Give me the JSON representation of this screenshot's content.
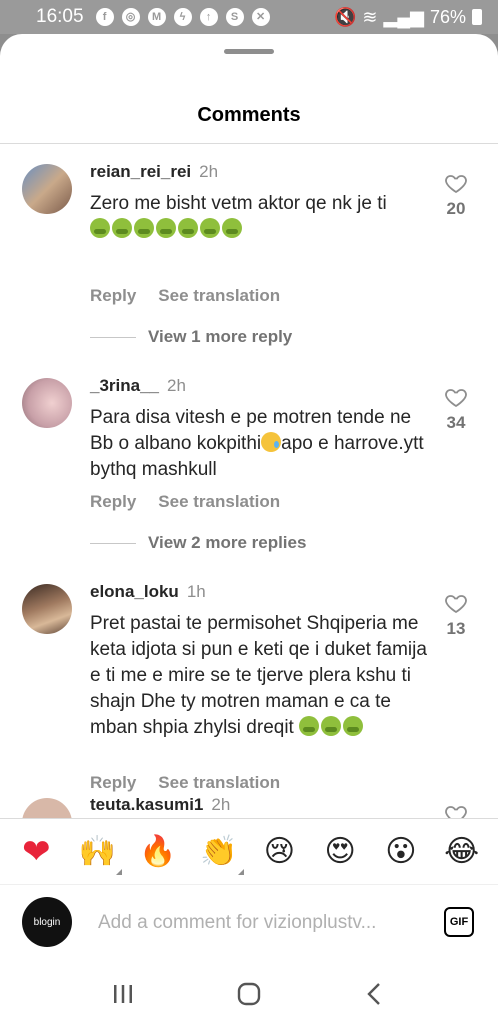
{
  "status_bar": {
    "time": "16:05",
    "battery": "76%",
    "icons": [
      "facebook-icon",
      "instagram-icon",
      "gmail-icon",
      "messenger-icon",
      "upload-icon",
      "shazam-icon",
      "close-box-icon",
      "mute-icon",
      "wifi-icon",
      "signal-icon",
      "battery-icon"
    ]
  },
  "sheet": {
    "title": "Comments"
  },
  "comments": [
    {
      "username": "reian_rei_rei",
      "time": "2h",
      "text": "Zero me bisht vetm aktor qe nk je ti ",
      "emoji_trail": [
        "nauseated-face",
        "vomiting-face",
        "vomiting-face",
        "vomiting-face",
        "vomiting-face",
        "vomiting-face",
        "vomiting-face"
      ],
      "reply_label": "Reply",
      "translate_label": "See translation",
      "likes": "20",
      "view_more": "View 1 more reply",
      "avatar_color": "#b8a08a"
    },
    {
      "username": "_3rina__",
      "time": "2h",
      "text_1": "Para disa vitesh e pe motren tende ne Bb o albano kokpithi",
      "text_2": "apo e harrove.ytt bythq mashkull",
      "reply_label": "Reply",
      "translate_label": "See translation",
      "likes": "34",
      "view_more": "View 2 more replies",
      "avatar_color": "#d9b5b5"
    },
    {
      "username": "elona_loku",
      "time": "1h",
      "text": "Pret pastai te permisohet Shqiperia me keta idjota si pun e keti qe i duket famija e ti me e mire se te tjerve plera kshu ti shajn Dhe ty motren maman e ca te mban shpia zhylsi dreqit ",
      "emoji_trail": [
        "vomiting-face",
        "vomiting-face",
        "vomiting-face"
      ],
      "reply_label": "Reply",
      "translate_label": "See translation",
      "likes": "13",
      "avatar_color": "#7a6050"
    },
    {
      "username": "teuta.kasumi1",
      "time": "2h",
      "avatar_color": "#c8a898"
    }
  ],
  "reactions": [
    {
      "name": "red-heart",
      "glyph": "❤"
    },
    {
      "name": "raising-hands",
      "glyph": "🙌"
    },
    {
      "name": "fire",
      "glyph": "🔥"
    },
    {
      "name": "clapping-hands",
      "glyph": "👏"
    },
    {
      "name": "crying-face",
      "glyph": "😢"
    },
    {
      "name": "heart-eyes",
      "glyph": "😍"
    },
    {
      "name": "astonished-face",
      "glyph": "😮"
    },
    {
      "name": "tears-of-joy",
      "glyph": "😂"
    }
  ],
  "input": {
    "placeholder": "Add a comment for vizionplustv...",
    "avatar_text": "blogin",
    "gif_label": "GIF"
  },
  "nav": {
    "buttons": [
      "recent-apps-icon",
      "home-icon",
      "back-icon"
    ]
  }
}
